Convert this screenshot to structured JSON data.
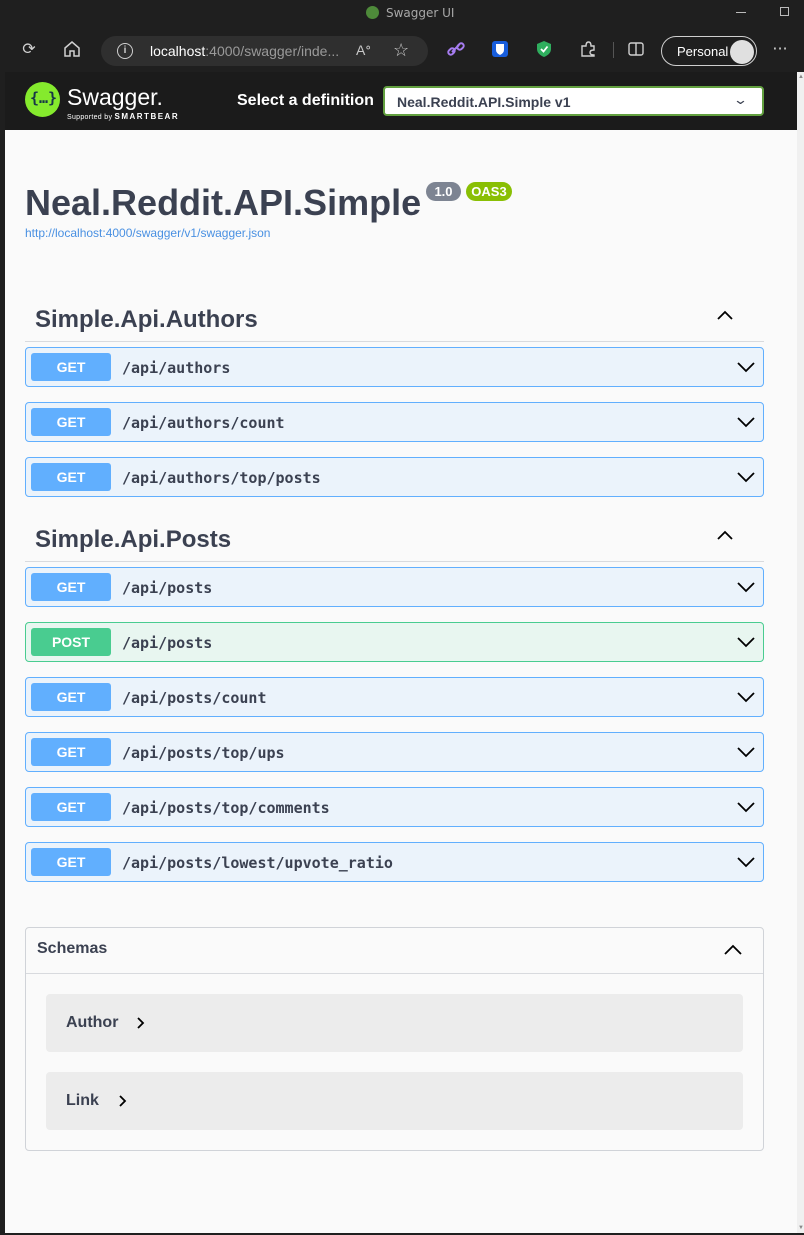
{
  "browser": {
    "tab_title": "Swagger UI",
    "url_host": "localhost",
    "url_rest": ":4000/swagger/inde...",
    "profile_label": "Personal"
  },
  "swagger": {
    "logo_text": "Swagger.",
    "logo_sub": "Supported by",
    "logo_sub_brand": "SMARTBEAR",
    "definition_label": "Select a definition",
    "definition_value": "Neal.Reddit.API.Simple v1"
  },
  "info": {
    "title": "Neal.Reddit.API.Simple",
    "version": "1.0",
    "oas": "OAS3",
    "spec_url": "http://localhost:4000/swagger/v1/swagger.json"
  },
  "tags": [
    {
      "name": "Simple.Api.Authors",
      "operations": [
        {
          "method": "GET",
          "path": "/api/authors"
        },
        {
          "method": "GET",
          "path": "/api/authors/count"
        },
        {
          "method": "GET",
          "path": "/api/authors/top/posts"
        }
      ]
    },
    {
      "name": "Simple.Api.Posts",
      "operations": [
        {
          "method": "GET",
          "path": "/api/posts"
        },
        {
          "method": "POST",
          "path": "/api/posts"
        },
        {
          "method": "GET",
          "path": "/api/posts/count"
        },
        {
          "method": "GET",
          "path": "/api/posts/top/ups"
        },
        {
          "method": "GET",
          "path": "/api/posts/top/comments"
        },
        {
          "method": "GET",
          "path": "/api/posts/lowest/upvote_ratio"
        }
      ]
    }
  ],
  "schemas": {
    "title": "Schemas",
    "models": [
      "Author",
      "Link"
    ]
  },
  "colors": {
    "get": "#61affe",
    "post": "#49cc90",
    "swagger_green": "#85ea2d",
    "text": "#3b4151"
  },
  "icons": {
    "refresh": "refresh-icon",
    "home": "home-icon",
    "info": "info-icon",
    "read_aloud": "read-aloud-icon",
    "favorite": "star-icon",
    "link_ext": "link-extension-icon",
    "bitwarden": "bitwarden-icon",
    "shield": "shield-icon",
    "extensions": "puzzle-icon",
    "split": "split-screen-icon",
    "more": "more-icon"
  }
}
